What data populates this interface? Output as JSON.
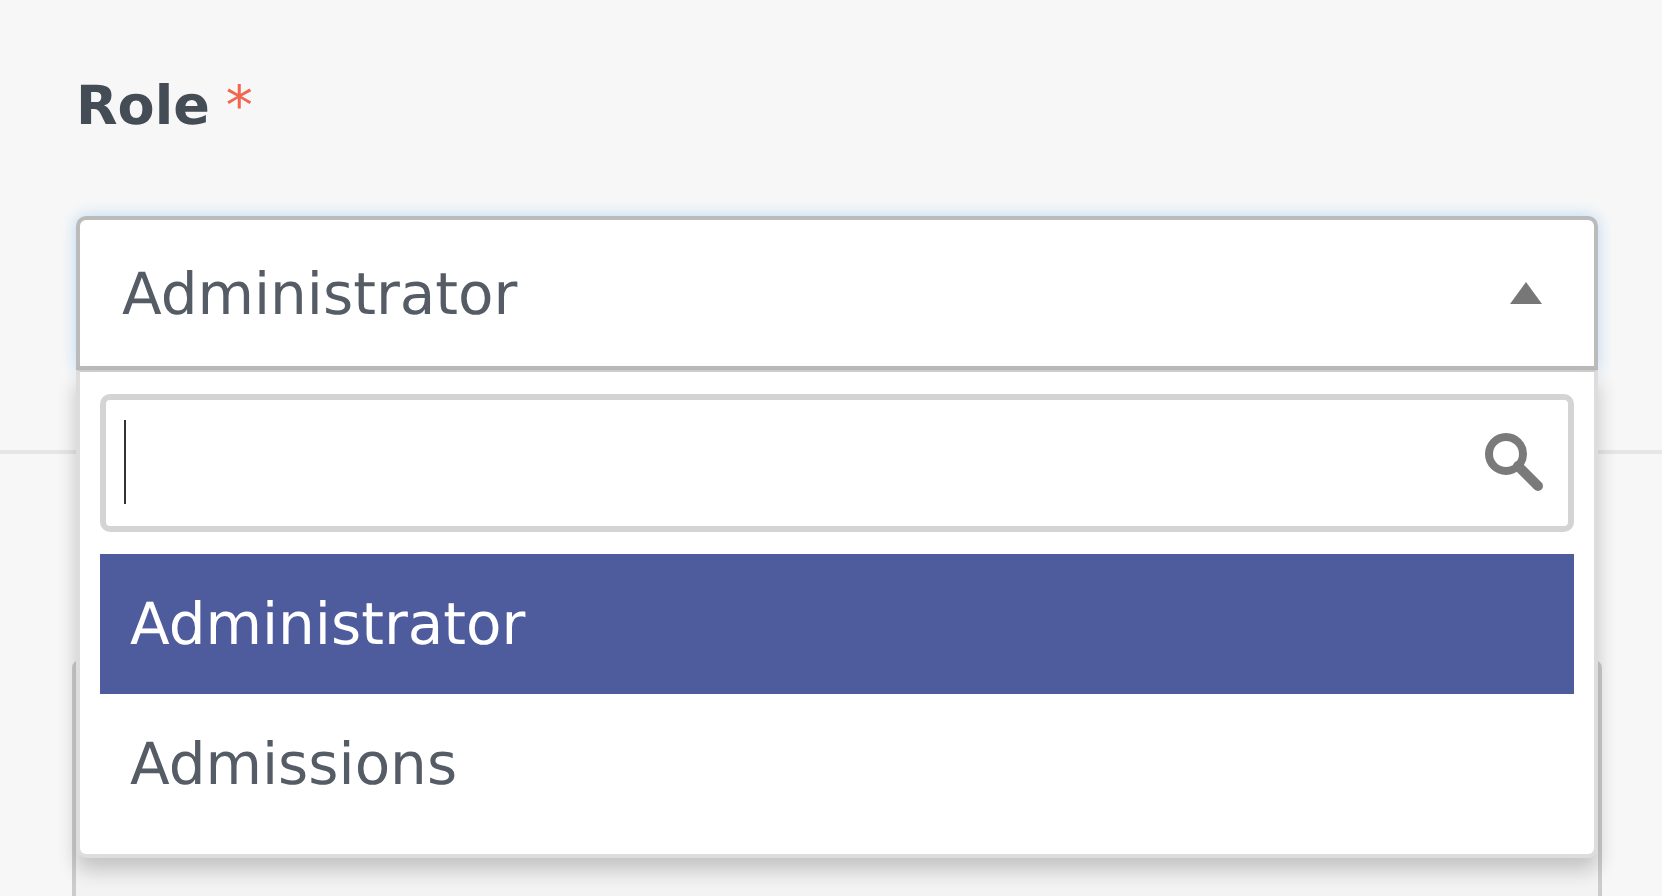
{
  "field": {
    "label": "Role",
    "required_mark": "*",
    "value": "Administrator",
    "expanded": true
  },
  "dropdown": {
    "options": [
      {
        "label": "Administrator",
        "selected": true
      },
      {
        "label": "Admissions",
        "selected": false
      }
    ]
  }
}
